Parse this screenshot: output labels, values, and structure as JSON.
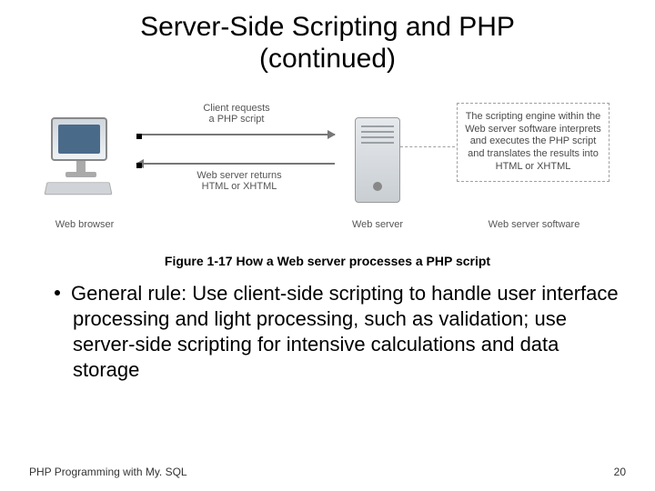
{
  "title_line1": "Server-Side Scripting and PHP",
  "title_line2": "(continued)",
  "figure": {
    "client_label": "Web browser",
    "server_label": "Web server",
    "callout_label": "Web server software",
    "arrow_top": "Client requests\na PHP script",
    "arrow_bottom": "Web server returns\nHTML or XHTML",
    "callout_text": "The scripting engine within the Web server software interprets and executes the PHP script and translates the results into HTML or XHTML"
  },
  "caption": "Figure 1-17 How a Web server processes a PHP script",
  "bullet": "General rule: Use client-side scripting to handle user interface processing and light processing, such as validation; use server-side scripting for intensive calculations and data storage",
  "footer_left": "PHP Programming with My. SQL",
  "footer_right": "20"
}
